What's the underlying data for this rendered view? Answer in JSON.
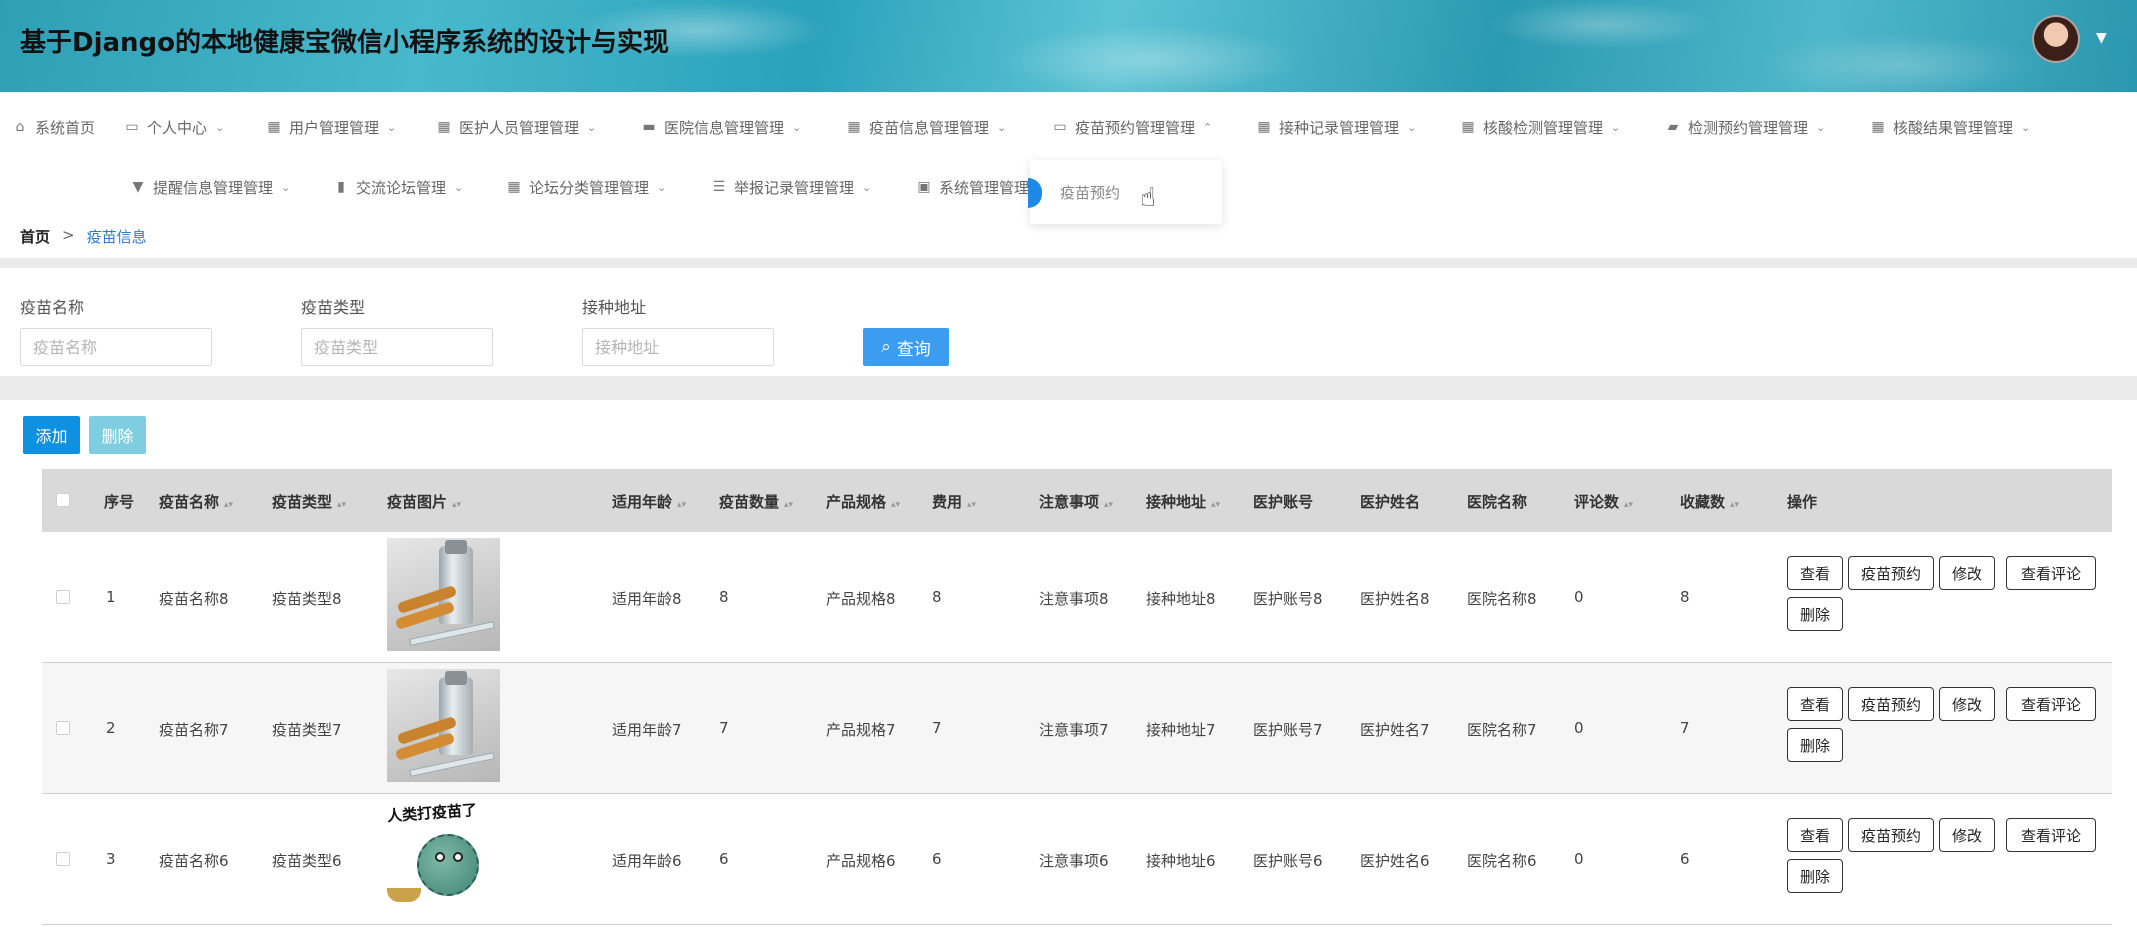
{
  "header": {
    "title": "基于Django的本地健康宝微信小程序系统的设计与实现"
  },
  "nav": {
    "row1": [
      {
        "label": "系统首页",
        "icon": "home-icon",
        "glyph": "⌂",
        "chevron": ""
      },
      {
        "label": "个人中心",
        "icon": "id-card-icon",
        "glyph": "▭",
        "chevron": "⌄"
      },
      {
        "label": "用户管理管理",
        "icon": "grid-icon",
        "glyph": "▦",
        "chevron": "⌄"
      },
      {
        "label": "医护人员管理管理",
        "icon": "grid-icon",
        "glyph": "▦",
        "chevron": "⌄"
      },
      {
        "label": "医院信息管理管理",
        "icon": "chat-icon",
        "glyph": "▬",
        "chevron": "⌄"
      },
      {
        "label": "疫苗信息管理管理",
        "icon": "grid-icon",
        "glyph": "▦",
        "chevron": "⌄"
      },
      {
        "label": "疫苗预约管理管理",
        "icon": "monitor-icon",
        "glyph": "▭",
        "chevron": "⌃"
      },
      {
        "label": "接种记录管理管理",
        "icon": "grid-icon",
        "glyph": "▦",
        "chevron": "⌄"
      },
      {
        "label": "核酸检测管理管理",
        "icon": "grid-icon",
        "glyph": "▦",
        "chevron": "⌄"
      },
      {
        "label": "检测预约管理管理",
        "icon": "ticket-icon",
        "glyph": "▰",
        "chevron": "⌄"
      },
      {
        "label": "核酸结果管理管理",
        "icon": "grid-icon",
        "glyph": "▦",
        "chevron": "⌄"
      }
    ],
    "row2": [
      {
        "label": "提醒信息管理管理",
        "icon": "brush-icon",
        "glyph": "▼",
        "chevron": "⌄"
      },
      {
        "label": "交流论坛管理",
        "icon": "chart-icon",
        "glyph": "▮",
        "chevron": "⌄"
      },
      {
        "label": "论坛分类管理管理",
        "icon": "grid-icon",
        "glyph": "▦",
        "chevron": "⌄"
      },
      {
        "label": "举报记录管理管理",
        "icon": "sliders-icon",
        "glyph": "☰",
        "chevron": "⌄"
      },
      {
        "label": "系统管理管理",
        "icon": "clipboard-icon",
        "glyph": "▣",
        "chevron": ""
      }
    ],
    "dropdown_item": "疫苗预约"
  },
  "breadcrumb": {
    "home": "首页",
    "sep": ">",
    "current": "疫苗信息"
  },
  "search": {
    "fields": [
      {
        "label": "疫苗名称",
        "placeholder": "疫苗名称"
      },
      {
        "label": "疫苗类型",
        "placeholder": "疫苗类型"
      },
      {
        "label": "接种地址",
        "placeholder": "接种地址"
      }
    ],
    "query_label": "查询"
  },
  "toolbar": {
    "add_label": "添加",
    "delete_label": "删除"
  },
  "table": {
    "columns": [
      "序号",
      "疫苗名称",
      "疫苗类型",
      "疫苗图片",
      "适用年龄",
      "疫苗数量",
      "产品规格",
      "费用",
      "注意事项",
      "接种地址",
      "医护账号",
      "医护姓名",
      "医院名称",
      "评论数",
      "收藏数",
      "操作"
    ],
    "rows": [
      {
        "index": "1",
        "name": "疫苗名称8",
        "type": "疫苗类型8",
        "image": "vial",
        "age": "适用年龄8",
        "quantity": "8",
        "spec": "产品规格8",
        "fee": "8",
        "notes": "注意事项8",
        "address": "接种地址8",
        "account": "医护账号8",
        "staff": "医护姓名8",
        "hospital": "医院名称8",
        "comments": "0",
        "favorites": "8"
      },
      {
        "index": "2",
        "name": "疫苗名称7",
        "type": "疫苗类型7",
        "image": "vial",
        "age": "适用年龄7",
        "quantity": "7",
        "spec": "产品规格7",
        "fee": "7",
        "notes": "注意事项7",
        "address": "接种地址7",
        "account": "医护账号7",
        "staff": "医护姓名7",
        "hospital": "医院名称7",
        "comments": "0",
        "favorites": "7"
      },
      {
        "index": "3",
        "name": "疫苗名称6",
        "type": "疫苗类型6",
        "image": "virus",
        "image_text": "人类打疫苗了",
        "age": "适用年龄6",
        "quantity": "6",
        "spec": "产品规格6",
        "fee": "6",
        "notes": "注意事项6",
        "address": "接种地址6",
        "account": "医护账号6",
        "staff": "医护姓名6",
        "hospital": "医院名称6",
        "comments": "0",
        "favorites": "6"
      }
    ],
    "actions": [
      "查看",
      "疫苗预约",
      "修改",
      "查看评论",
      "删除"
    ]
  },
  "colors": {
    "primary": "#0e91e0",
    "query": "#3c9cf0",
    "delete_disabled": "#7fcde0",
    "link": "#2b7bd0"
  }
}
